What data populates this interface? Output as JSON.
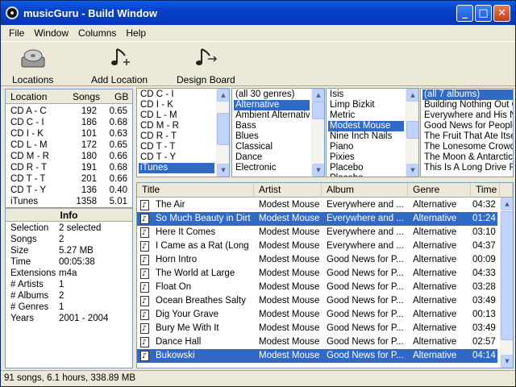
{
  "window": {
    "title": "musicGuru - Build Window",
    "min": "_",
    "max": "□",
    "close": "✕"
  },
  "menu": [
    "File",
    "Window",
    "Columns",
    "Help"
  ],
  "toolbar": {
    "locations": "Locations",
    "add_location": "Add Location",
    "design_board": "Design Board"
  },
  "locations": {
    "headers": [
      "Location",
      "Songs",
      "GB"
    ],
    "rows": [
      [
        "CD A - C",
        "192",
        "0.65"
      ],
      [
        "CD C - I",
        "186",
        "0.68"
      ],
      [
        "CD I - K",
        "101",
        "0.63"
      ],
      [
        "CD L - M",
        "172",
        "0.65"
      ],
      [
        "CD M - R",
        "180",
        "0.66"
      ],
      [
        "CD R - T",
        "191",
        "0.68"
      ],
      [
        "CD T - T",
        "201",
        "0.66"
      ],
      [
        "CD T - Y",
        "136",
        "0.40"
      ],
      [
        "iTunes",
        "1358",
        "5.01"
      ]
    ]
  },
  "info": {
    "title": "Info",
    "rows": [
      [
        "Selection",
        "2 selected"
      ],
      [
        "Songs",
        "2"
      ],
      [
        "Size",
        "5.27 MB"
      ],
      [
        "Time",
        "00:05:38"
      ],
      [
        "Extensions",
        "m4a"
      ],
      [
        "# Artists",
        "1"
      ],
      [
        "# Albums",
        "2"
      ],
      [
        "# Genres",
        "1"
      ],
      [
        "Years",
        "2001 - 2004"
      ]
    ]
  },
  "filters": {
    "locations": {
      "items": [
        "CD C - I",
        "CD I - K",
        "CD L - M",
        "CD M - R",
        "CD R - T",
        "CD T - T",
        "CD T - Y",
        "iTunes"
      ],
      "selected": 7
    },
    "genres": {
      "items": [
        "(all 30 genres)",
        "Alternative",
        "Ambient Alternative",
        "Bass",
        "Blues",
        "Classical",
        "Dance",
        "Electronic"
      ],
      "selected": 1
    },
    "artists": {
      "items": [
        "Isis",
        "Limp Bizkit",
        "Metric",
        "Modest Mouse",
        "Nine Inch Nails",
        "Piano",
        "Pixies",
        "Placebo",
        "Placebo"
      ],
      "selected": 3
    },
    "albums": {
      "items": [
        "(all 7 albums)",
        "Building Nothing Out Of",
        "Everywhere and His Na",
        "Good News for People W",
        "The Fruit That Ate Itself",
        "The Lonesome Crowde",
        "The Moon & Antarctica",
        "This Is A Long Drive Fo"
      ],
      "selected": 0
    }
  },
  "songs": {
    "headers": [
      "Title",
      "Artist",
      "Album",
      "Genre",
      "Time"
    ],
    "rows": [
      {
        "title": "The Air",
        "artist": "Modest Mouse",
        "album": "Everywhere and ...",
        "genre": "Alternative",
        "time": "04:32",
        "sel": false
      },
      {
        "title": "So Much Beauty in Dirt",
        "artist": "Modest Mouse",
        "album": "Everywhere and ...",
        "genre": "Alternative",
        "time": "01:24",
        "sel": true
      },
      {
        "title": "Here It Comes",
        "artist": "Modest Mouse",
        "album": "Everywhere and ...",
        "genre": "Alternative",
        "time": "03:10",
        "sel": false
      },
      {
        "title": "I Came as a Rat (Long ...",
        "artist": "Modest Mouse",
        "album": "Everywhere and ...",
        "genre": "Alternative",
        "time": "04:37",
        "sel": false
      },
      {
        "title": "Horn Intro",
        "artist": "Modest Mouse",
        "album": "Good News for P...",
        "genre": "Alternative",
        "time": "00:09",
        "sel": false
      },
      {
        "title": "The World at Large",
        "artist": "Modest Mouse",
        "album": "Good News for P...",
        "genre": "Alternative",
        "time": "04:33",
        "sel": false
      },
      {
        "title": "Float On",
        "artist": "Modest Mouse",
        "album": "Good News for P...",
        "genre": "Alternative",
        "time": "03:28",
        "sel": false
      },
      {
        "title": "Ocean Breathes Salty",
        "artist": "Modest Mouse",
        "album": "Good News for P...",
        "genre": "Alternative",
        "time": "03:49",
        "sel": false
      },
      {
        "title": "Dig Your Grave",
        "artist": "Modest Mouse",
        "album": "Good News for P...",
        "genre": "Alternative",
        "time": "00:13",
        "sel": false
      },
      {
        "title": "Bury Me With It",
        "artist": "Modest Mouse",
        "album": "Good News for P...",
        "genre": "Alternative",
        "time": "03:49",
        "sel": false
      },
      {
        "title": "Dance Hall",
        "artist": "Modest Mouse",
        "album": "Good News for P...",
        "genre": "Alternative",
        "time": "02:57",
        "sel": false
      },
      {
        "title": "Bukowski",
        "artist": "Modest Mouse",
        "album": "Good News for P...",
        "genre": "Alternative",
        "time": "04:14",
        "sel": true
      }
    ]
  },
  "status": "91 songs, 6.1 hours, 338.89 MB",
  "colors": {
    "selection": "#316ac5",
    "titlebar": "#0a5de8",
    "chrome": "#ece9d8"
  }
}
